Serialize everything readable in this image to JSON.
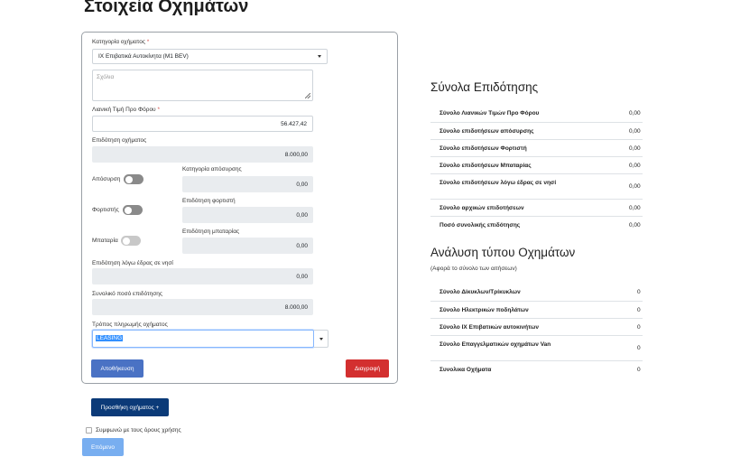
{
  "page": {
    "title": "Στοιχεία Οχημάτων"
  },
  "form": {
    "vehicle_category": {
      "label": "Κατηγορία οχήματος",
      "required_mark": "*",
      "value": "ΙΧ Επιβατικά Αυτοκίνητα (Μ1 BEV)"
    },
    "comments": {
      "placeholder": "Σχόλια"
    },
    "retail_price": {
      "label": "Λιανική Τιμή Προ Φόρου",
      "required_mark": "*",
      "value": "56.427,42"
    },
    "vehicle_subsidy": {
      "label": "Επιδότηση οχήματος",
      "value": "8.000,00"
    },
    "scrappage": {
      "toggle_label": "Απόσυρση",
      "category_label": "Κατηγορία απόσυρσης",
      "value": "0,00"
    },
    "charger": {
      "toggle_label": "Φορτιστής",
      "subsidy_label": "Επιδότηση φορτιστή",
      "value": "0,00"
    },
    "battery": {
      "toggle_label": "Μπαταρία",
      "subsidy_label": "Επιδότηση μπαταρίας",
      "value": "0,00"
    },
    "island_subsidy": {
      "label": "Επιδότηση λόγω έδρας σε νησί",
      "value": "0,00"
    },
    "total_subsidy": {
      "label": "Συνολικό ποσό επιδότησης",
      "value": "8.000,00"
    },
    "payment_method": {
      "label": "Τρόπος πληρωμής οχήματος",
      "value": "LEASING"
    },
    "save_button": "Αποθήκευση",
    "delete_button": "Διαγραφή"
  },
  "add_vehicle_button": "Προσθήκη οχήματος +",
  "terms_label": "Συμφωνώ με τους όρους χρήσης",
  "next_button": "Επόμενο",
  "subsidy_totals": {
    "title": "Σύνολα Επιδότησης",
    "rows": [
      {
        "label": "Σύνολο Λιανικών Τιμών Προ Φόρου",
        "value": "0,00"
      },
      {
        "label": "Σύνολο επιδοτήσεων απόσυρσης",
        "value": "0,00"
      },
      {
        "label": "Σύνολο επιδοτήσεων Φορτιστή",
        "value": "0,00"
      },
      {
        "label": "Σύνολο επιδοτήσεων Μπαταρίας",
        "value": "0,00"
      },
      {
        "label": "Σύνολο επιδοτήσεων λόγω έδρας σε νησί",
        "value": "0,00"
      },
      {
        "label": "Σύνολο αρχικών επιδοτήσεων",
        "value": "0,00"
      },
      {
        "label": "Ποσό συνολικής επιδότησης",
        "value": "0,00"
      }
    ]
  },
  "vehicle_types": {
    "title": "Ανάλυση τύπου Οχημάτων",
    "subtitle": "(Αφορά το σύνολο των αιτήσεων)",
    "rows": [
      {
        "label": "Σύνολο Δίκυκλων/Τρίκυκλων",
        "value": "0"
      },
      {
        "label": "Σύνολο Ηλεκτρικών ποδηλάτων",
        "value": "0"
      },
      {
        "label": "Σύνολο ΙΧ Επιβατικών αυτοκινήτων",
        "value": "0"
      },
      {
        "label": "Σύνολο Επαγγελματικών οχημάτων Van",
        "value": "0"
      },
      {
        "label": "Συνολικα Οχήματα",
        "value": "0"
      }
    ]
  },
  "colors": {
    "primary": "#4a72c4",
    "dark_primary": "#0b3a78",
    "danger": "#d32f2f",
    "next_disabled": "#78aef0"
  }
}
